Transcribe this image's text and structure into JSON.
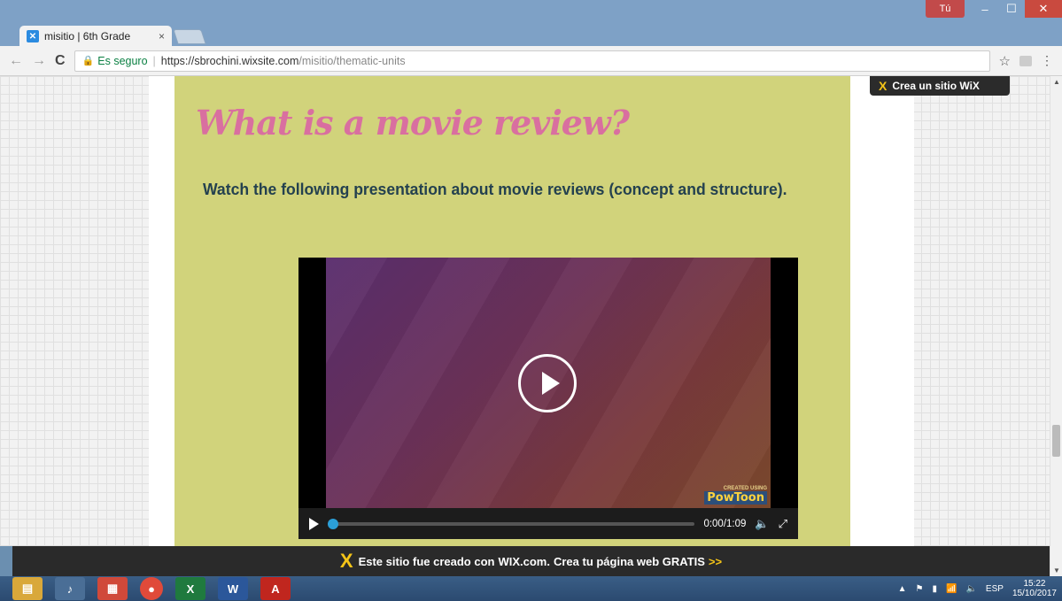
{
  "browser": {
    "tab_title": "misitio | 6th Grade",
    "tab_close": "×",
    "user_label": "Tú",
    "secure_label": "Es seguro",
    "url_host": "https://sbrochini.wixsite.com",
    "url_path": "/misitio/thematic-units"
  },
  "page": {
    "heading": "What is a movie review?",
    "subheading": "Watch the following presentation about movie reviews (concept and structure).",
    "wix_badge": "Crea un sitio WiX"
  },
  "video": {
    "time": "0:00/1:09",
    "progress_fraction": 0,
    "watermark_small": "CREATED USING",
    "watermark_brand": "PowToon"
  },
  "banner": {
    "text_before": "Este sitio fue creado con",
    "brand": "WIX.com.",
    "text_after": "Crea tu página web GRATIS",
    "arrows": ">>"
  },
  "taskbar": {
    "language": "ESP",
    "time": "15:22",
    "date": "15/10/2017"
  }
}
